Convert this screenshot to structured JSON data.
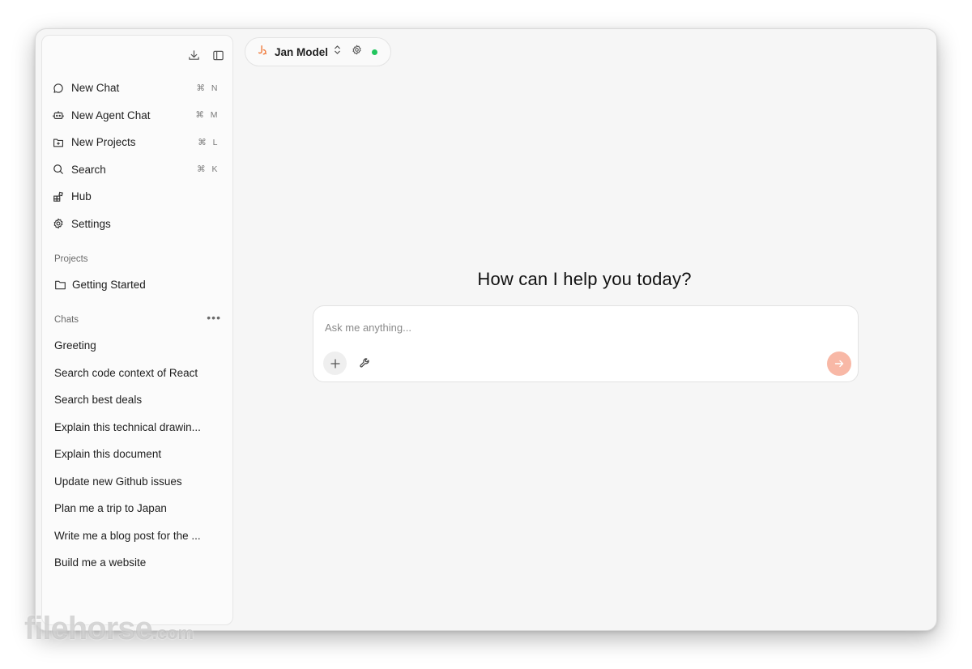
{
  "sidebar": {
    "top_icons": [
      "download-icon",
      "sidebar-toggle-icon"
    ],
    "menu": [
      {
        "label": "New Chat",
        "icon": "chat-bubble-icon",
        "shortcut": "⌘ N"
      },
      {
        "label": "New Agent Chat",
        "icon": "robot-icon",
        "shortcut": "⌘ M"
      },
      {
        "label": "New Projects",
        "icon": "folder-plus-icon",
        "shortcut": "⌘ L"
      },
      {
        "label": "Search",
        "icon": "search-icon",
        "shortcut": "⌘ K"
      },
      {
        "label": "Hub",
        "icon": "hub-icon",
        "shortcut": ""
      },
      {
        "label": "Settings",
        "icon": "gear-icon",
        "shortcut": ""
      }
    ],
    "projects_label": "Projects",
    "projects": [
      {
        "label": "Getting Started",
        "icon": "folder-icon"
      }
    ],
    "chats_label": "Chats",
    "chats_more": "•••",
    "chats": [
      "Greeting",
      "Search code context of React",
      "Search best deals",
      "Explain this technical drawin...",
      "Explain this document",
      "Update new Github issues",
      "Plan me a trip to Japan",
      "Write me a blog post for the ...",
      "Build me a website"
    ]
  },
  "model_selector": {
    "name": "Jan Model",
    "status": "online",
    "status_color": "#22c55e"
  },
  "main": {
    "welcome": "How can I help you today?",
    "input_placeholder": "Ask me anything...",
    "input_value": ""
  },
  "watermark": {
    "text": "filehorse",
    "suffix": ".com"
  },
  "colors": {
    "accent": "#f8b8a6",
    "logo": "#f07a3a",
    "background": "#f6f6f6"
  }
}
